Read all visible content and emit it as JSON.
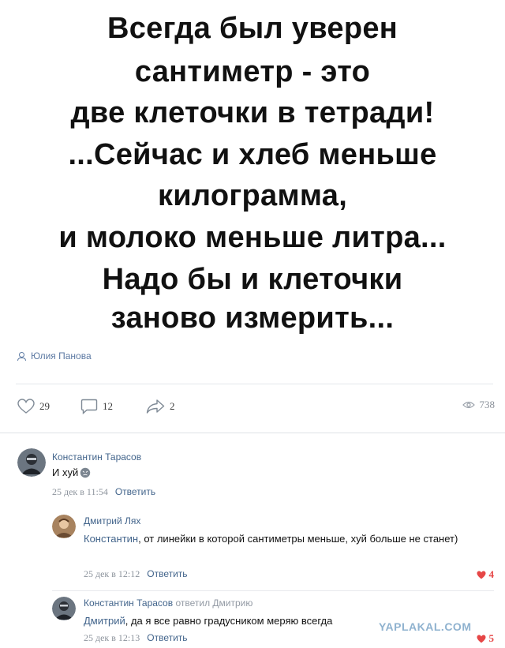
{
  "post": {
    "quote_lines": [
      "Всегда был   уверен",
      "сантиметр - это",
      "две клеточки в тетради!",
      "...Сейчас и хлеб меньше",
      "килограмма,",
      "и молоко меньше литра...",
      "Надо бы и клеточки",
      "заново измерить..."
    ],
    "author": "Юлия Панова",
    "likes": "29",
    "comments": "12",
    "shares": "2",
    "views": "738"
  },
  "comments": [
    {
      "author": "Константин Тарасов",
      "text": "И хуй",
      "date": "25 дек в 11:54",
      "reply_label": "Ответить"
    },
    {
      "author": "Дмитрий Лях",
      "mention": "Константин",
      "text": ", от линейки в которой сантиметры меньше, хуй больше не станет)",
      "date": "25 дек в 12:12",
      "reply_label": "Ответить",
      "likes": "4"
    },
    {
      "author": "Константин Тарасов",
      "replied_to": "ответил Дмитрию",
      "mention": "Дмитрий",
      "text": ", да я все равно градусником меряю всегда",
      "date": "25 дек в 12:13",
      "reply_label": "Ответить",
      "likes": "5"
    }
  ],
  "watermark": "YAPLAKAL.COM",
  "colors": {
    "link": "#42648b",
    "like_red": "#e64646",
    "muted": "#8c939c"
  }
}
